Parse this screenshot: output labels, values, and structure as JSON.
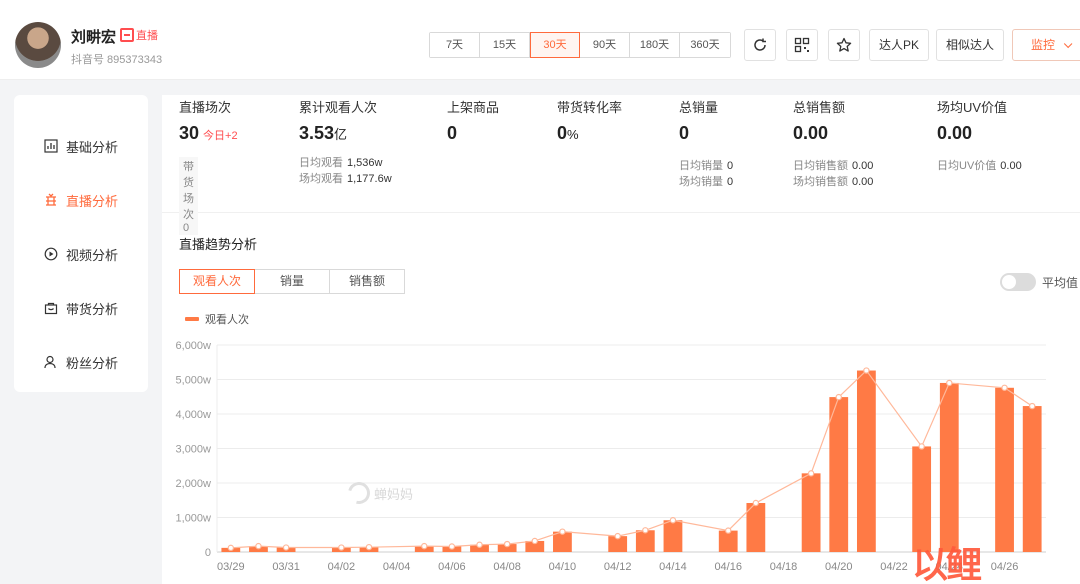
{
  "profile": {
    "name": "刘畊宏",
    "uid": "抖音号 895373343",
    "live_badge": "直播"
  },
  "range_options": [
    "7天",
    "15天",
    "30天",
    "90天",
    "180天",
    "360天"
  ],
  "range_selected": "30天",
  "header_actions": {
    "pk_label": "达人PK",
    "similar_label": "相似达人",
    "monitor_label": "监控"
  },
  "sidebar": {
    "items": [
      {
        "label": "基础分析",
        "icon": "bar-chart-icon"
      },
      {
        "label": "直播分析",
        "icon": "live-icon"
      },
      {
        "label": "视频分析",
        "icon": "play-circle-icon"
      },
      {
        "label": "带货分析",
        "icon": "shopping-bag-icon"
      },
      {
        "label": "粉丝分析",
        "icon": "user-icon"
      }
    ],
    "active": "直播分析"
  },
  "stats": {
    "live_count": {
      "label": "直播场次",
      "value": "30",
      "today": "今日+2",
      "sub": "带货场次 0"
    },
    "views": {
      "label": "累计观看人次",
      "value": "3.53",
      "unit": "亿",
      "daily_label": "日均观看",
      "daily_value": "1,536w",
      "avg_label": "场均观看",
      "avg_value": "1,177.6w"
    },
    "products": {
      "label": "上架商品",
      "value": "0"
    },
    "conversion": {
      "label": "带货转化率",
      "value": "0",
      "unit": "%"
    },
    "sales_qty": {
      "label": "总销量",
      "value": "0",
      "daily_label": "日均销量",
      "daily_value": "0",
      "avg_label": "场均销量",
      "avg_value": "0"
    },
    "sales_amount": {
      "label": "总销售额",
      "value": "0.00",
      "daily_label": "日均销售额",
      "daily_value": "0.00",
      "avg_label": "场均销售额",
      "avg_value": "0.00"
    },
    "uv": {
      "label": "场均UV价值",
      "value": "0.00",
      "daily_label": "日均UV价值",
      "daily_value": "0.00"
    }
  },
  "trend": {
    "title": "直播趋势分析",
    "tabs": [
      "观看人次",
      "销量",
      "销售额"
    ],
    "active_tab": "观看人次",
    "toggle_label": "平均值"
  },
  "watermark": "蝉妈妈",
  "corner_logo": "以鲤",
  "colors": {
    "accent": "#ff6a3c",
    "bar": "#ff7a45",
    "line": "#ffb89a"
  },
  "chart_data": {
    "type": "bar",
    "legend": [
      "观看人次"
    ],
    "y_ticks": [
      "0",
      "1,000w",
      "2,000w",
      "3,000w",
      "4,000w",
      "5,000w",
      "6,000w"
    ],
    "ylim": [
      0,
      6000
    ],
    "x_tick_labels": [
      "03/29",
      "03/31",
      "04/02",
      "04/04",
      "04/06",
      "04/08",
      "04/10",
      "04/12",
      "04/14",
      "04/16",
      "04/18",
      "04/20",
      "04/22",
      "04/24",
      "04/26"
    ],
    "categories": [
      "03/29",
      "03/30",
      "03/31",
      "04/01",
      "04/02",
      "04/03",
      "04/04",
      "04/05",
      "04/06",
      "04/07",
      "04/08",
      "04/09",
      "04/10",
      "04/11",
      "04/12",
      "04/13",
      "04/14",
      "04/15",
      "04/16",
      "04/17",
      "04/18",
      "04/19",
      "04/20",
      "04/21",
      "04/22",
      "04/23",
      "04/24",
      "04/25",
      "04/26",
      "04/27"
    ],
    "series": [
      {
        "name": "观看人次",
        "values": [
          120,
          170,
          130,
          0,
          130,
          140,
          0,
          170,
          160,
          210,
          230,
          320,
          590,
          0,
          460,
          630,
          920,
          0,
          620,
          1420,
          0,
          2280,
          4490,
          5260,
          0,
          3060,
          4900,
          0,
          4760,
          4230
        ]
      }
    ],
    "grid": true
  }
}
